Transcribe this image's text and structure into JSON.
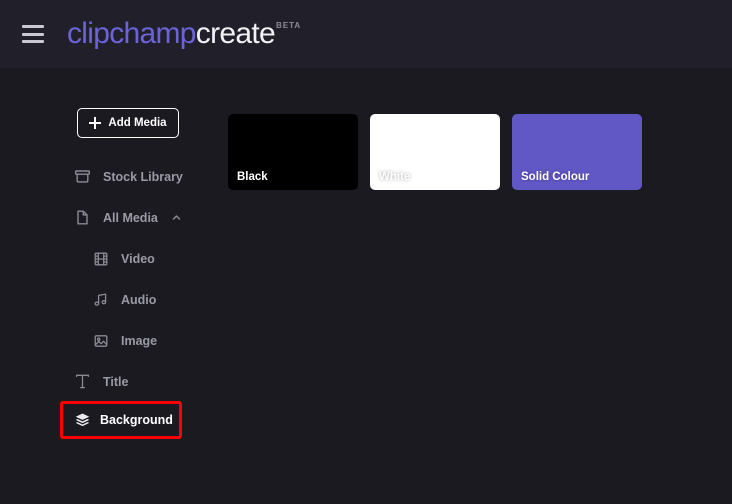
{
  "header": {
    "menu_icon": "hamburger-menu-icon",
    "brand_part1": "clipchamp",
    "brand_part2": "create",
    "badge": "BETA"
  },
  "sidebar": {
    "add_media": {
      "label": "Add Media",
      "icon": "plus-icon"
    },
    "items": [
      {
        "label": "Stock Library",
        "icon": "stock-library-icon",
        "level": 1,
        "expander": ""
      },
      {
        "label": "All Media",
        "icon": "all-media-file-icon",
        "level": 1,
        "expander": "chevron-up-icon"
      },
      {
        "label": "Video",
        "icon": "video-film-icon",
        "level": 2,
        "expander": ""
      },
      {
        "label": "Audio",
        "icon": "audio-note-icon",
        "level": 2,
        "expander": ""
      },
      {
        "label": "Image",
        "icon": "image-picture-icon",
        "level": 2,
        "expander": ""
      },
      {
        "label": "Title",
        "icon": "title-text-icon",
        "level": 1,
        "expander": ""
      }
    ],
    "highlighted_item": {
      "label": "Background",
      "icon": "layers-icon",
      "highlight_color": "#ff0000"
    }
  },
  "content": {
    "tiles": [
      {
        "label": "Black",
        "color": "#000000",
        "label_color": "#ffffff"
      },
      {
        "label": "White",
        "color": "#ffffff",
        "label_color": "#ffffff"
      },
      {
        "label": "Solid Colour",
        "color": "#6158c6",
        "label_color": "#ffffff"
      }
    ]
  },
  "colors": {
    "header_bg": "#21202a",
    "body_bg": "#1b1a21",
    "brand_purple": "#6c63d8",
    "muted_text": "#9a9aa6",
    "highlight_red": "#ff0000"
  }
}
